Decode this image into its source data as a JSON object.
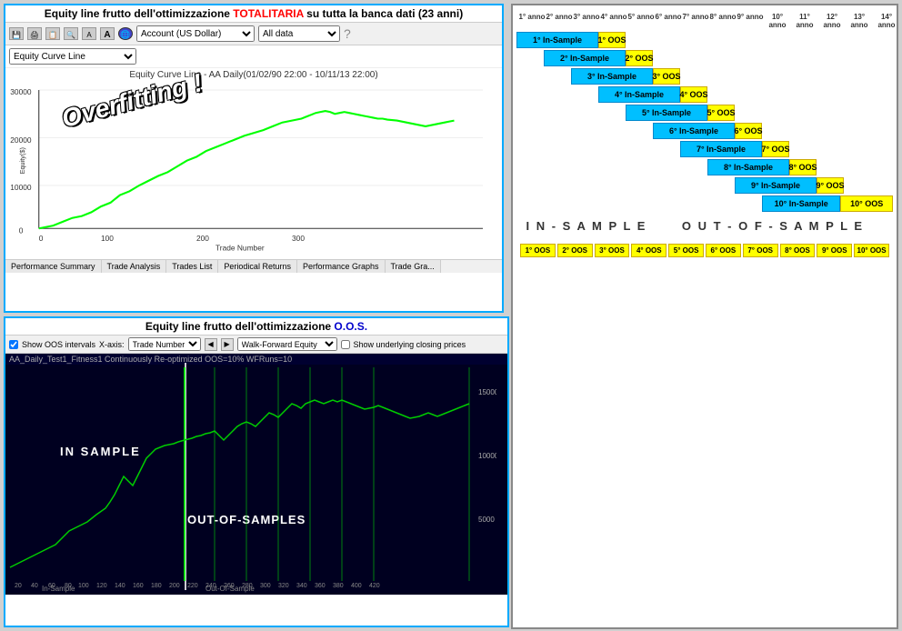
{
  "topLeft": {
    "title": "Equity line frutto dell'ottimizzazione ",
    "titleRed": "TOTALITARIA",
    "titleEnd": " su tutta la banca dati (23 anni)",
    "toolbar": {
      "account": "Account (US Dollar)",
      "allData": "All data"
    },
    "dropdown": "Equity Curve Line",
    "chartTitle": "Equity Curve Line - AA Daily(01/02/90 22:00 - 10/11/13 22:00)",
    "overfitting": "Overfitting !",
    "tabs": [
      "Performance Summary",
      "Trade Analysis",
      "Trades List",
      "Periodical Returns",
      "Performance Graphs",
      "Trade Gra..."
    ]
  },
  "bottomLeft": {
    "title": "Equity line frutto dell'ottimizzazione ",
    "titleBlue": "O.O.S.",
    "toolbar": {
      "showOOS": "Show OOS intervals",
      "xaxis": "X-axis:",
      "xvalue": "Trade Number",
      "dropdown": "Walk-Forward Equity",
      "showClosing": "Show underlying closing prices"
    },
    "chartLabel": "AA_Daily_Test1_Fitness1 Continuously Re-optimized OOS=10% WFRuns=10",
    "inSample": "IN SAMPLE",
    "outSample": "OUT-OF-SAMPLES",
    "bottomLabels": [
      "In-Sample",
      "Out-Of-Sample"
    ]
  },
  "rightPanel": {
    "years": [
      "1° anno",
      "2° anno",
      "3° anno",
      "4° anno",
      "5° anno",
      "6° anno",
      "7° anno",
      "8° anno",
      "9° anno",
      "10° anno",
      "11° anno",
      "12° anno",
      "13° anno",
      "14° anno"
    ],
    "rows": [
      {
        "isLabel": "1° In-Sample",
        "isSpan": 3,
        "isOffset": 0,
        "oosLabel": "1° OOS",
        "oosSpan": 1,
        "oosOffset": 3
      },
      {
        "isLabel": "2° In-Sample",
        "isSpan": 3,
        "isOffset": 1,
        "oosLabel": "2° OOS",
        "oosSpan": 1,
        "oosOffset": 4
      },
      {
        "isLabel": "3° In-Sample",
        "isSpan": 3,
        "isOffset": 2,
        "oosLabel": "3° OOS",
        "oosSpan": 1,
        "oosOffset": 5
      },
      {
        "isLabel": "4° In-Sample",
        "isSpan": 3,
        "isOffset": 3,
        "oosLabel": "4° OOS",
        "oosSpan": 1,
        "oosOffset": 6
      },
      {
        "isLabel": "5° In-Sample",
        "isSpan": 3,
        "isOffset": 4,
        "oosLabel": "5° OOS",
        "oosSpan": 1,
        "oosOffset": 7
      },
      {
        "isLabel": "6° In-Sample",
        "isSpan": 3,
        "isOffset": 5,
        "oosLabel": "6° OOS",
        "oosSpan": 1,
        "oosOffset": 8
      },
      {
        "isLabel": "7° In-Sample",
        "isSpan": 3,
        "isOffset": 6,
        "oosLabel": "7° OOS",
        "oosSpan": 1,
        "oosOffset": 9
      },
      {
        "isLabel": "8° In-Sample",
        "isSpan": 3,
        "isOffset": 7,
        "oosLabel": "8° OOS",
        "oosSpan": 1,
        "oosOffset": 10
      },
      {
        "isLabel": "9° In-Sample",
        "isSpan": 3,
        "isOffset": 8,
        "oosLabel": "9° OOS",
        "oosSpan": 1,
        "oosOffset": 11
      },
      {
        "isLabel": "10° In-Sample",
        "isSpan": 3,
        "isOffset": 9,
        "oosLabel": "10° OOS",
        "oosSpan": 2,
        "oosOffset": 12
      }
    ],
    "inSampleRegion": "I N - S A M P L E",
    "outSampleRegion": "O U T - O F - S A M P L E",
    "bottomOOS": [
      "1° OOS",
      "2° OOS",
      "3° OOS",
      "4° OOS",
      "5° OOS",
      "6° OOS",
      "7° OOS",
      "8° OOS",
      "9° OOS",
      "10° OOS"
    ]
  }
}
